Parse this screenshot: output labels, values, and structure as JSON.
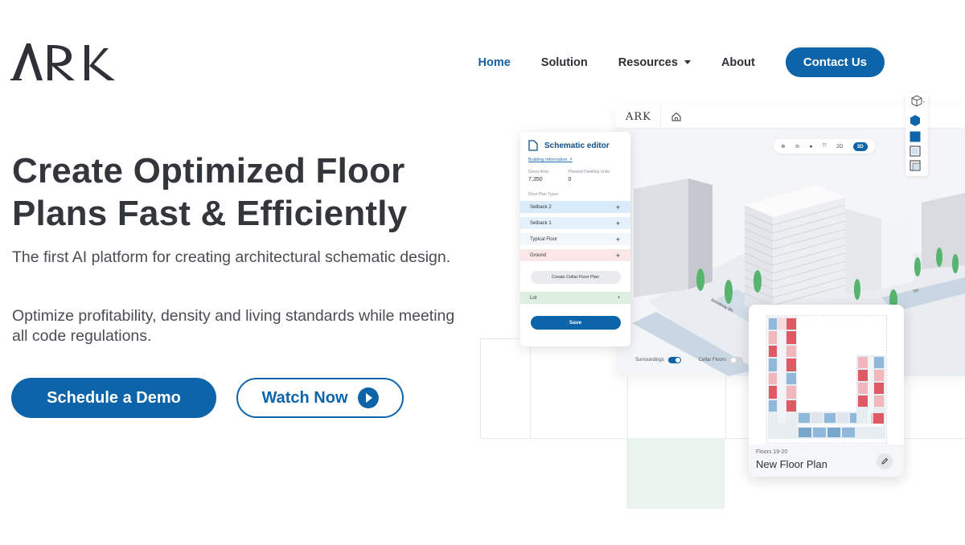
{
  "brand": {
    "logo_text": "ARK"
  },
  "nav": {
    "items": [
      {
        "label": "Home",
        "active": true
      },
      {
        "label": "Solution",
        "active": false
      },
      {
        "label": "Resources",
        "active": false,
        "has_dropdown": true
      },
      {
        "label": "About",
        "active": false
      }
    ],
    "contact_label": "Contact Us"
  },
  "hero": {
    "title_line1": "Create Optimized Floor",
    "title_line2": "Plans Fast & Efficiently",
    "para1": "The first AI platform for creating architectural schematic design.",
    "para2": "Optimize profitability, density and living standards while meeting all code regulations.",
    "demo_label": "Schedule a Demo",
    "watch_label": "Watch Now"
  },
  "app": {
    "logo_text": "ARK",
    "view_modes": {
      "mode_2d": "2D",
      "mode_3d": "3D",
      "active": "3D"
    },
    "street_label_1": "Broadway Blv",
    "street_label_2": "5th",
    "surroundings_label": "Surroundings",
    "surroundings_on": true,
    "cellar_label": "Cellar Floors",
    "cellar_on": false,
    "editor": {
      "title": "Schematic editor",
      "building_info_link": "Building Information",
      "gross_area_label": "Gross Area",
      "gross_area_value": "7,350",
      "dwelling_units_label": "Planned Dwelling Units",
      "dwelling_units_value": "0",
      "floor_plan_types_label": "Floor Plan Types",
      "floor_types": [
        {
          "label": "Setback 2",
          "color": "#d7ebfb"
        },
        {
          "label": "Setback 1",
          "color": "#e4f1fb"
        },
        {
          "label": "Typical Floor",
          "color": "#f2f7fc"
        },
        {
          "label": "Ground",
          "color": "#fbe7e8"
        }
      ],
      "create_cellar_label": "Create Cellar Floor Plan",
      "lot_label": "Lot",
      "save_label": "Save"
    },
    "floor_card": {
      "floors": "Floors 19-20",
      "name": "New Floor Plan"
    }
  },
  "colors": {
    "brand_blue": "#0d64a8",
    "nav_active": "#1a5fa0",
    "text_dark": "#33363a",
    "plan_red": "#e05a66",
    "plan_pink": "#f2b7bd",
    "plan_blue": "#8fb8da",
    "tree_green": "#56b46e"
  },
  "icons": {
    "play": "play-icon",
    "home": "home-icon",
    "cube": "cube-icon",
    "edit": "pencil-icon",
    "doc": "document-icon"
  }
}
